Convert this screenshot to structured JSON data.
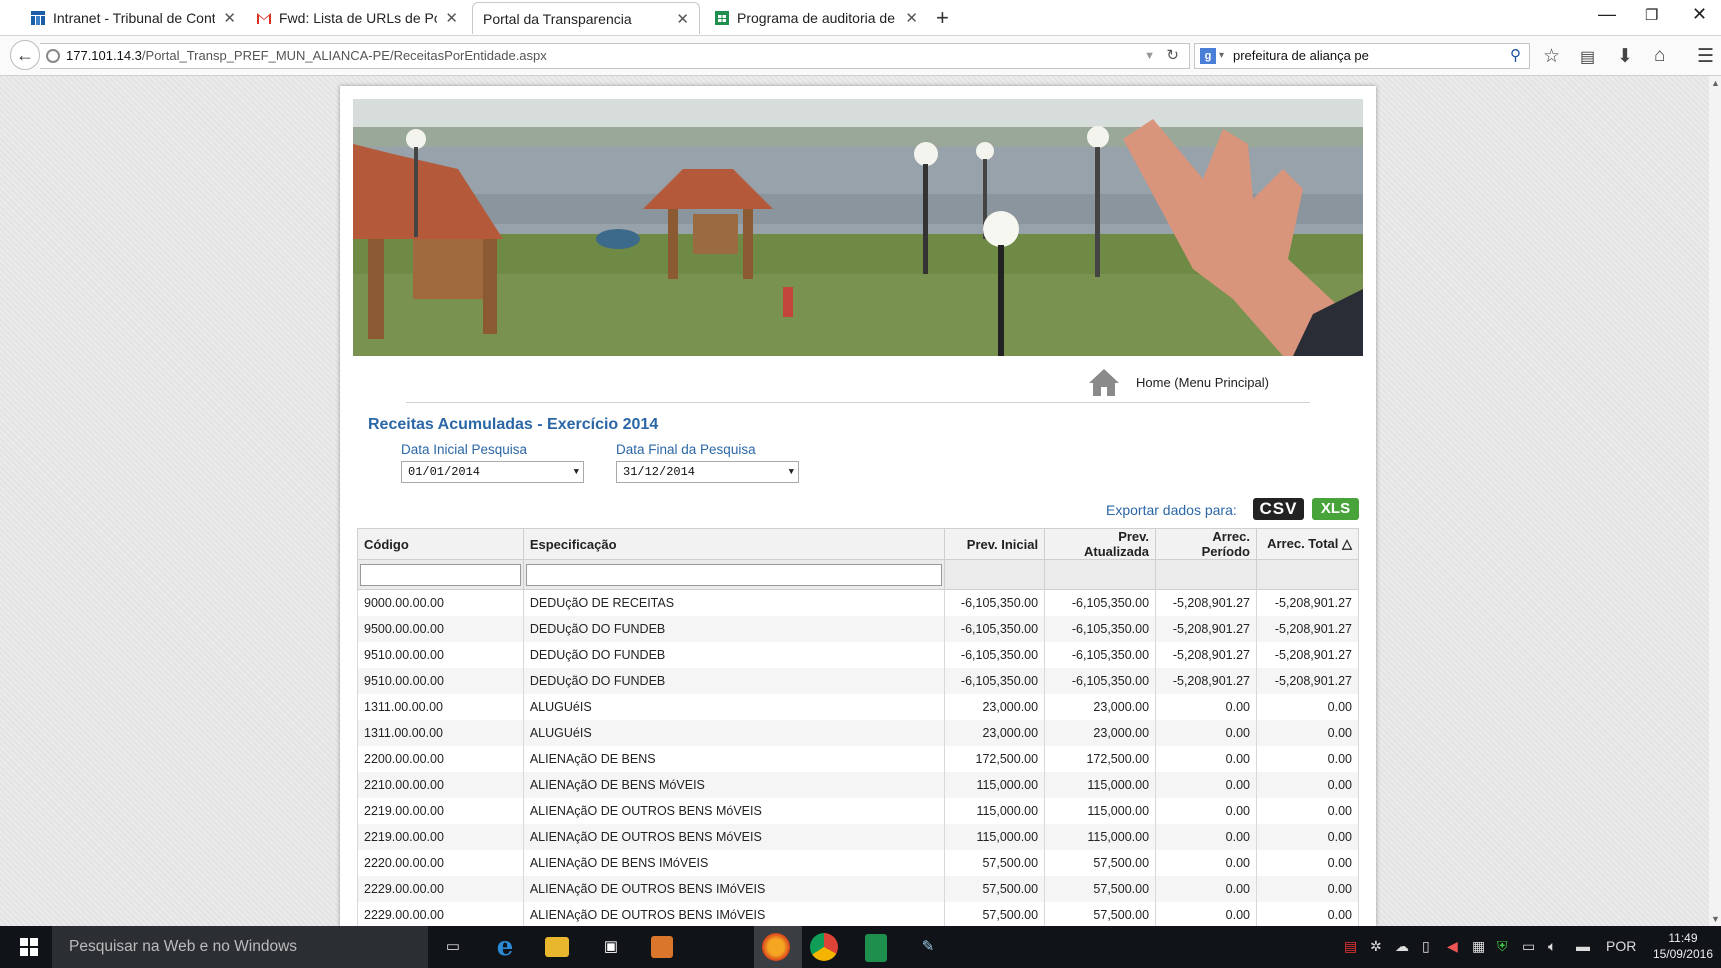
{
  "browser": {
    "tabs": [
      {
        "title": "Intranet - Tribunal de Cont...",
        "icon": "tribunal-icon"
      },
      {
        "title": "Fwd: Lista de URLs de Port...",
        "icon": "gmail-icon"
      },
      {
        "title": "Portal da Transparencia",
        "icon": ""
      },
      {
        "title": "Programa de auditoria de ...",
        "icon": "sheets-icon"
      }
    ],
    "url_host": "177.101.14.3",
    "url_path": "/Portal_Transp_PREF_MUN_ALIANCA-PE/ReceitasPorEntidade.aspx",
    "search_value": "prefeitura de aliança pe"
  },
  "page": {
    "home_label": "Home (Menu Principal)",
    "title": "Receitas Acumuladas - Exercício 2014",
    "date_start_label": "Data Inicial Pesquisa",
    "date_start_value": "01/01/2014",
    "date_end_label": "Data Final da Pesquisa",
    "date_end_value": "31/12/2014",
    "export_label": "Exportar dados para:",
    "export_csv": "CSV",
    "export_xls": "XLS"
  },
  "table": {
    "headers": [
      "Código",
      "Especificação",
      "Prev. Inicial",
      "Prev. Atualizada",
      "Arrec. Período",
      "Arrec. Total △"
    ],
    "rows": [
      [
        "9000.00.00.00",
        "DEDUçãO DE RECEITAS",
        "-6,105,350.00",
        "-6,105,350.00",
        "-5,208,901.27",
        "-5,208,901.27"
      ],
      [
        "9500.00.00.00",
        "DEDUçãO DO FUNDEB",
        "-6,105,350.00",
        "-6,105,350.00",
        "-5,208,901.27",
        "-5,208,901.27"
      ],
      [
        "9510.00.00.00",
        "DEDUçãO DO FUNDEB",
        "-6,105,350.00",
        "-6,105,350.00",
        "-5,208,901.27",
        "-5,208,901.27"
      ],
      [
        "9510.00.00.00",
        "DEDUçãO DO FUNDEB",
        "-6,105,350.00",
        "-6,105,350.00",
        "-5,208,901.27",
        "-5,208,901.27"
      ],
      [
        "1311.00.00.00",
        "ALUGUéIS",
        "23,000.00",
        "23,000.00",
        "0.00",
        "0.00"
      ],
      [
        "1311.00.00.00",
        "ALUGUéIS",
        "23,000.00",
        "23,000.00",
        "0.00",
        "0.00"
      ],
      [
        "2200.00.00.00",
        "ALIENAçãO DE BENS",
        "172,500.00",
        "172,500.00",
        "0.00",
        "0.00"
      ],
      [
        "2210.00.00.00",
        "ALIENAçãO DE BENS MóVEIS",
        "115,000.00",
        "115,000.00",
        "0.00",
        "0.00"
      ],
      [
        "2219.00.00.00",
        "ALIENAçãO DE OUTROS BENS MóVEIS",
        "115,000.00",
        "115,000.00",
        "0.00",
        "0.00"
      ],
      [
        "2219.00.00.00",
        "ALIENAçãO DE OUTROS BENS MóVEIS",
        "115,000.00",
        "115,000.00",
        "0.00",
        "0.00"
      ],
      [
        "2220.00.00.00",
        "ALIENAçãO DE BENS IMóVEIS",
        "57,500.00",
        "57,500.00",
        "0.00",
        "0.00"
      ],
      [
        "2229.00.00.00",
        "ALIENAçãO DE OUTROS BENS IMóVEIS",
        "57,500.00",
        "57,500.00",
        "0.00",
        "0.00"
      ],
      [
        "2229.00.00.00",
        "ALIENAçãO DE OUTROS BENS IMóVEIS",
        "57,500.00",
        "57,500.00",
        "0.00",
        "0.00"
      ]
    ]
  },
  "taskbar": {
    "search_placeholder": "Pesquisar na Web e no Windows",
    "language": "POR",
    "time": "11:49",
    "date": "15/09/2016"
  },
  "colors": {
    "accent": "#2b67a6",
    "csv_button": "#222222",
    "xls_button": "#49a33b"
  }
}
